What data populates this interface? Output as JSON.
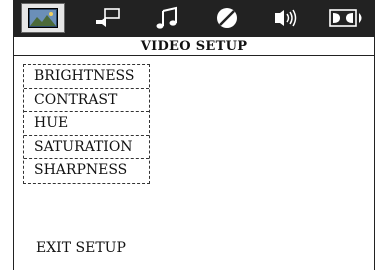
{
  "tabs": [
    {
      "icon": "picture-icon",
      "selected": true
    },
    {
      "icon": "speaker-icon",
      "selected": false
    },
    {
      "icon": "music-note-icon",
      "selected": false
    },
    {
      "icon": "contrast-circle-icon",
      "selected": false
    },
    {
      "icon": "sound-wave-icon",
      "selected": false
    },
    {
      "icon": "dolby-icon",
      "selected": false
    }
  ],
  "colors": {
    "tabbar": "#222222",
    "selected_tab": "#e6e6e6",
    "icon": "#ffffff",
    "text": "#111111"
  },
  "title": "VIDEO SETUP",
  "menu_items": [
    "BRIGHTNESS",
    "CONTRAST",
    "HUE",
    "SATURATION",
    "SHARPNESS"
  ],
  "exit_label": "EXIT SETUP"
}
